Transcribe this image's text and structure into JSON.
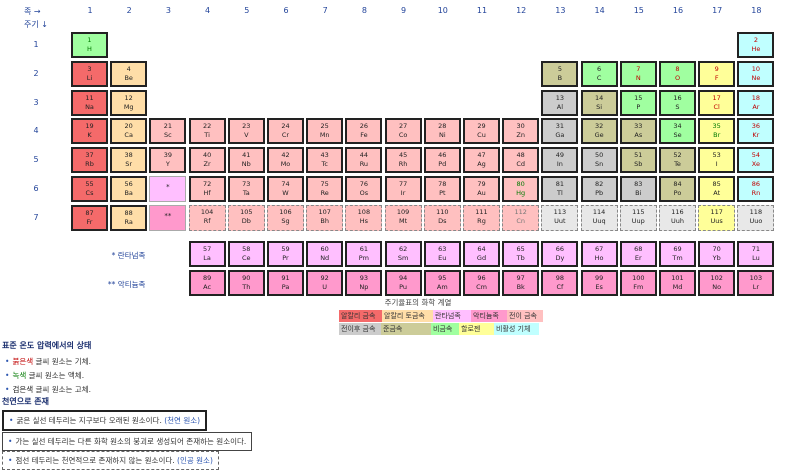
{
  "header": {
    "group_label": "족 →",
    "period_label": "주기 ↓"
  },
  "groups": [
    "1",
    "2",
    "3",
    "4",
    "5",
    "6",
    "7",
    "8",
    "9",
    "10",
    "11",
    "12",
    "13",
    "14",
    "15",
    "16",
    "17",
    "18"
  ],
  "periods": [
    "1",
    "2",
    "3",
    "4",
    "5",
    "6",
    "7"
  ],
  "colors": {
    "alkali": "#f46a6a",
    "alkaline": "#ffdea8",
    "lanthanide": "#ffbfff",
    "actinide": "#ff99cc",
    "transition": "#ffc0c0",
    "post_transition": "#cccccc",
    "metalloid": "#cccc99",
    "nonmetal": "#a0ffa0",
    "halogen": "#ffff99",
    "noble": "#c0ffff",
    "unknown": "#e8e8e8"
  },
  "text_colors": {
    "red": "#c00000",
    "green": "#007a00",
    "black": "#222222",
    "gray": "#777777"
  },
  "elements": [
    {
      "n": "1",
      "s": "H",
      "g": 1,
      "p": 1,
      "c": "nonmetal",
      "t": "green",
      "b": "nat"
    },
    {
      "n": "2",
      "s": "He",
      "g": 18,
      "p": 1,
      "c": "noble",
      "t": "red",
      "b": "nat"
    },
    {
      "n": "3",
      "s": "Li",
      "g": 1,
      "p": 2,
      "c": "alkali",
      "t": "black",
      "b": "nat"
    },
    {
      "n": "4",
      "s": "Be",
      "g": 2,
      "p": 2,
      "c": "alkaline",
      "t": "black",
      "b": "nat"
    },
    {
      "n": "5",
      "s": "B",
      "g": 13,
      "p": 2,
      "c": "metalloid",
      "t": "black",
      "b": "nat"
    },
    {
      "n": "6",
      "s": "C",
      "g": 14,
      "p": 2,
      "c": "nonmetal",
      "t": "black",
      "b": "nat"
    },
    {
      "n": "7",
      "s": "N",
      "g": 15,
      "p": 2,
      "c": "nonmetal",
      "t": "red",
      "b": "nat"
    },
    {
      "n": "8",
      "s": "O",
      "g": 16,
      "p": 2,
      "c": "nonmetal",
      "t": "red",
      "b": "nat"
    },
    {
      "n": "9",
      "s": "F",
      "g": 17,
      "p": 2,
      "c": "halogen",
      "t": "red",
      "b": "nat"
    },
    {
      "n": "10",
      "s": "Ne",
      "g": 18,
      "p": 2,
      "c": "noble",
      "t": "red",
      "b": "nat"
    },
    {
      "n": "11",
      "s": "Na",
      "g": 1,
      "p": 3,
      "c": "alkali",
      "t": "black",
      "b": "nat"
    },
    {
      "n": "12",
      "s": "Mg",
      "g": 2,
      "p": 3,
      "c": "alkaline",
      "t": "black",
      "b": "nat"
    },
    {
      "n": "13",
      "s": "Al",
      "g": 13,
      "p": 3,
      "c": "post_transition",
      "t": "black",
      "b": "nat"
    },
    {
      "n": "14",
      "s": "Si",
      "g": 14,
      "p": 3,
      "c": "metalloid",
      "t": "black",
      "b": "nat"
    },
    {
      "n": "15",
      "s": "P",
      "g": 15,
      "p": 3,
      "c": "nonmetal",
      "t": "black",
      "b": "nat"
    },
    {
      "n": "16",
      "s": "S",
      "g": 16,
      "p": 3,
      "c": "nonmetal",
      "t": "black",
      "b": "nat"
    },
    {
      "n": "17",
      "s": "Cl",
      "g": 17,
      "p": 3,
      "c": "halogen",
      "t": "red",
      "b": "nat"
    },
    {
      "n": "18",
      "s": "Ar",
      "g": 18,
      "p": 3,
      "c": "noble",
      "t": "red",
      "b": "nat"
    },
    {
      "n": "19",
      "s": "K",
      "g": 1,
      "p": 4,
      "c": "alkali",
      "t": "black",
      "b": "nat"
    },
    {
      "n": "20",
      "s": "Ca",
      "g": 2,
      "p": 4,
      "c": "alkaline",
      "t": "black",
      "b": "nat"
    },
    {
      "n": "21",
      "s": "Sc",
      "g": 3,
      "p": 4,
      "c": "transition",
      "t": "black",
      "b": "nat"
    },
    {
      "n": "22",
      "s": "Ti",
      "g": 4,
      "p": 4,
      "c": "transition",
      "t": "black",
      "b": "nat"
    },
    {
      "n": "23",
      "s": "V",
      "g": 5,
      "p": 4,
      "c": "transition",
      "t": "black",
      "b": "nat"
    },
    {
      "n": "24",
      "s": "Cr",
      "g": 6,
      "p": 4,
      "c": "transition",
      "t": "black",
      "b": "nat"
    },
    {
      "n": "25",
      "s": "Mn",
      "g": 7,
      "p": 4,
      "c": "transition",
      "t": "black",
      "b": "nat"
    },
    {
      "n": "26",
      "s": "Fe",
      "g": 8,
      "p": 4,
      "c": "transition",
      "t": "black",
      "b": "nat"
    },
    {
      "n": "27",
      "s": "Co",
      "g": 9,
      "p": 4,
      "c": "transition",
      "t": "black",
      "b": "nat"
    },
    {
      "n": "28",
      "s": "Ni",
      "g": 10,
      "p": 4,
      "c": "transition",
      "t": "black",
      "b": "nat"
    },
    {
      "n": "29",
      "s": "Cu",
      "g": 11,
      "p": 4,
      "c": "transition",
      "t": "black",
      "b": "nat"
    },
    {
      "n": "30",
      "s": "Zn",
      "g": 12,
      "p": 4,
      "c": "transition",
      "t": "black",
      "b": "nat"
    },
    {
      "n": "31",
      "s": "Ga",
      "g": 13,
      "p": 4,
      "c": "post_transition",
      "t": "black",
      "b": "nat"
    },
    {
      "n": "32",
      "s": "Ge",
      "g": 14,
      "p": 4,
      "c": "metalloid",
      "t": "black",
      "b": "nat"
    },
    {
      "n": "33",
      "s": "As",
      "g": 15,
      "p": 4,
      "c": "metalloid",
      "t": "black",
      "b": "nat"
    },
    {
      "n": "34",
      "s": "Se",
      "g": 16,
      "p": 4,
      "c": "nonmetal",
      "t": "black",
      "b": "nat"
    },
    {
      "n": "35",
      "s": "Br",
      "g": 17,
      "p": 4,
      "c": "halogen",
      "t": "green",
      "b": "nat"
    },
    {
      "n": "36",
      "s": "Kr",
      "g": 18,
      "p": 4,
      "c": "noble",
      "t": "red",
      "b": "nat"
    },
    {
      "n": "37",
      "s": "Rb",
      "g": 1,
      "p": 5,
      "c": "alkali",
      "t": "black",
      "b": "nat"
    },
    {
      "n": "38",
      "s": "Sr",
      "g": 2,
      "p": 5,
      "c": "alkaline",
      "t": "black",
      "b": "nat"
    },
    {
      "n": "39",
      "s": "Y",
      "g": 3,
      "p": 5,
      "c": "transition",
      "t": "black",
      "b": "nat"
    },
    {
      "n": "40",
      "s": "Zr",
      "g": 4,
      "p": 5,
      "c": "transition",
      "t": "black",
      "b": "nat"
    },
    {
      "n": "41",
      "s": "Nb",
      "g": 5,
      "p": 5,
      "c": "transition",
      "t": "black",
      "b": "nat"
    },
    {
      "n": "42",
      "s": "Mo",
      "g": 6,
      "p": 5,
      "c": "transition",
      "t": "black",
      "b": "nat"
    },
    {
      "n": "43",
      "s": "Tc",
      "g": 7,
      "p": 5,
      "c": "transition",
      "t": "black",
      "b": "nat"
    },
    {
      "n": "44",
      "s": "Ru",
      "g": 8,
      "p": 5,
      "c": "transition",
      "t": "black",
      "b": "nat"
    },
    {
      "n": "45",
      "s": "Rh",
      "g": 9,
      "p": 5,
      "c": "transition",
      "t": "black",
      "b": "nat"
    },
    {
      "n": "46",
      "s": "Pd",
      "g": 10,
      "p": 5,
      "c": "transition",
      "t": "black",
      "b": "nat"
    },
    {
      "n": "47",
      "s": "Ag",
      "g": 11,
      "p": 5,
      "c": "transition",
      "t": "black",
      "b": "nat"
    },
    {
      "n": "48",
      "s": "Cd",
      "g": 12,
      "p": 5,
      "c": "transition",
      "t": "black",
      "b": "nat"
    },
    {
      "n": "49",
      "s": "In",
      "g": 13,
      "p": 5,
      "c": "post_transition",
      "t": "black",
      "b": "nat"
    },
    {
      "n": "50",
      "s": "Sn",
      "g": 14,
      "p": 5,
      "c": "post_transition",
      "t": "black",
      "b": "nat"
    },
    {
      "n": "51",
      "s": "Sb",
      "g": 15,
      "p": 5,
      "c": "metalloid",
      "t": "black",
      "b": "nat"
    },
    {
      "n": "52",
      "s": "Te",
      "g": 16,
      "p": 5,
      "c": "metalloid",
      "t": "black",
      "b": "nat"
    },
    {
      "n": "53",
      "s": "I",
      "g": 17,
      "p": 5,
      "c": "halogen",
      "t": "black",
      "b": "nat"
    },
    {
      "n": "54",
      "s": "Xe",
      "g": 18,
      "p": 5,
      "c": "noble",
      "t": "red",
      "b": "nat"
    },
    {
      "n": "55",
      "s": "Cs",
      "g": 1,
      "p": 6,
      "c": "alkali",
      "t": "black",
      "b": "nat"
    },
    {
      "n": "56",
      "s": "Ba",
      "g": 2,
      "p": 6,
      "c": "alkaline",
      "t": "black",
      "b": "nat"
    },
    {
      "n": "*",
      "s": "",
      "g": 3,
      "p": 6,
      "c": "lanthanide",
      "t": "black",
      "b": "star"
    },
    {
      "n": "72",
      "s": "Hf",
      "g": 4,
      "p": 6,
      "c": "transition",
      "t": "black",
      "b": "nat"
    },
    {
      "n": "73",
      "s": "Ta",
      "g": 5,
      "p": 6,
      "c": "transition",
      "t": "black",
      "b": "nat"
    },
    {
      "n": "74",
      "s": "W",
      "g": 6,
      "p": 6,
      "c": "transition",
      "t": "black",
      "b": "nat"
    },
    {
      "n": "75",
      "s": "Re",
      "g": 7,
      "p": 6,
      "c": "transition",
      "t": "black",
      "b": "nat"
    },
    {
      "n": "76",
      "s": "Os",
      "g": 8,
      "p": 6,
      "c": "transition",
      "t": "black",
      "b": "nat"
    },
    {
      "n": "77",
      "s": "Ir",
      "g": 9,
      "p": 6,
      "c": "transition",
      "t": "black",
      "b": "nat"
    },
    {
      "n": "78",
      "s": "Pt",
      "g": 10,
      "p": 6,
      "c": "transition",
      "t": "black",
      "b": "nat"
    },
    {
      "n": "79",
      "s": "Au",
      "g": 11,
      "p": 6,
      "c": "transition",
      "t": "black",
      "b": "nat"
    },
    {
      "n": "80",
      "s": "Hg",
      "g": 12,
      "p": 6,
      "c": "transition",
      "t": "green",
      "b": "nat"
    },
    {
      "n": "81",
      "s": "Tl",
      "g": 13,
      "p": 6,
      "c": "post_transition",
      "t": "black",
      "b": "nat"
    },
    {
      "n": "82",
      "s": "Pb",
      "g": 14,
      "p": 6,
      "c": "post_transition",
      "t": "black",
      "b": "nat"
    },
    {
      "n": "83",
      "s": "Bi",
      "g": 15,
      "p": 6,
      "c": "post_transition",
      "t": "black",
      "b": "nat"
    },
    {
      "n": "84",
      "s": "Po",
      "g": 16,
      "p": 6,
      "c": "metalloid",
      "t": "black",
      "b": "nat"
    },
    {
      "n": "85",
      "s": "At",
      "g": 17,
      "p": 6,
      "c": "halogen",
      "t": "black",
      "b": "nat"
    },
    {
      "n": "86",
      "s": "Rn",
      "g": 18,
      "p": 6,
      "c": "noble",
      "t": "red",
      "b": "nat"
    },
    {
      "n": "87",
      "s": "Fr",
      "g": 1,
      "p": 7,
      "c": "alkali",
      "t": "black",
      "b": "nat"
    },
    {
      "n": "88",
      "s": "Ra",
      "g": 2,
      "p": 7,
      "c": "alkaline",
      "t": "black",
      "b": "nat"
    },
    {
      "n": "**",
      "s": "",
      "g": 3,
      "p": 7,
      "c": "actinide",
      "t": "black",
      "b": "star"
    },
    {
      "n": "104",
      "s": "Rf",
      "g": 4,
      "p": 7,
      "c": "transition",
      "t": "black",
      "b": "syn"
    },
    {
      "n": "105",
      "s": "Db",
      "g": 5,
      "p": 7,
      "c": "transition",
      "t": "black",
      "b": "syn"
    },
    {
      "n": "106",
      "s": "Sg",
      "g": 6,
      "p": 7,
      "c": "transition",
      "t": "black",
      "b": "syn"
    },
    {
      "n": "107",
      "s": "Bh",
      "g": 7,
      "p": 7,
      "c": "transition",
      "t": "black",
      "b": "syn"
    },
    {
      "n": "108",
      "s": "Hs",
      "g": 8,
      "p": 7,
      "c": "transition",
      "t": "black",
      "b": "syn"
    },
    {
      "n": "109",
      "s": "Mt",
      "g": 9,
      "p": 7,
      "c": "transition",
      "t": "black",
      "b": "syn"
    },
    {
      "n": "110",
      "s": "Ds",
      "g": 10,
      "p": 7,
      "c": "transition",
      "t": "black",
      "b": "syn"
    },
    {
      "n": "111",
      "s": "Rg",
      "g": 11,
      "p": 7,
      "c": "transition",
      "t": "black",
      "b": "syn"
    },
    {
      "n": "112",
      "s": "Cn",
      "g": 12,
      "p": 7,
      "c": "transition",
      "t": "gray",
      "b": "syn"
    },
    {
      "n": "113",
      "s": "Uut",
      "g": 13,
      "p": 7,
      "c": "unknown",
      "t": "black",
      "b": "syn"
    },
    {
      "n": "114",
      "s": "Uuq",
      "g": 14,
      "p": 7,
      "c": "unknown",
      "t": "black",
      "b": "syn"
    },
    {
      "n": "115",
      "s": "Uup",
      "g": 15,
      "p": 7,
      "c": "unknown",
      "t": "black",
      "b": "syn"
    },
    {
      "n": "116",
      "s": "Uuh",
      "g": 16,
      "p": 7,
      "c": "unknown",
      "t": "black",
      "b": "syn"
    },
    {
      "n": "117",
      "s": "Uus",
      "g": 17,
      "p": 7,
      "c": "halogen",
      "t": "black",
      "b": "syn"
    },
    {
      "n": "118",
      "s": "Uuo",
      "g": 18,
      "p": 7,
      "c": "unknown",
      "t": "black",
      "b": "syn"
    }
  ],
  "series": [
    {
      "label": "* 란타넘족",
      "row": 1,
      "c": "lanthanide",
      "items": [
        {
          "n": "57",
          "s": "La"
        },
        {
          "n": "58",
          "s": "Ce"
        },
        {
          "n": "59",
          "s": "Pr"
        },
        {
          "n": "60",
          "s": "Nd"
        },
        {
          "n": "61",
          "s": "Pm"
        },
        {
          "n": "62",
          "s": "Sm"
        },
        {
          "n": "63",
          "s": "Eu"
        },
        {
          "n": "64",
          "s": "Gd"
        },
        {
          "n": "65",
          "s": "Tb"
        },
        {
          "n": "66",
          "s": "Dy"
        },
        {
          "n": "67",
          "s": "Ho"
        },
        {
          "n": "68",
          "s": "Er"
        },
        {
          "n": "69",
          "s": "Tm"
        },
        {
          "n": "70",
          "s": "Yb"
        },
        {
          "n": "71",
          "s": "Lu"
        }
      ]
    },
    {
      "label": "** 악티늄족",
      "row": 2,
      "c": "actinide",
      "items": [
        {
          "n": "89",
          "s": "Ac"
        },
        {
          "n": "90",
          "s": "Th"
        },
        {
          "n": "91",
          "s": "Pa"
        },
        {
          "n": "92",
          "s": "U"
        },
        {
          "n": "93",
          "s": "Np"
        },
        {
          "n": "94",
          "s": "Pu"
        },
        {
          "n": "95",
          "s": "Am"
        },
        {
          "n": "96",
          "s": "Cm"
        },
        {
          "n": "97",
          "s": "Bk"
        },
        {
          "n": "98",
          "s": "Cf"
        },
        {
          "n": "99",
          "s": "Es"
        },
        {
          "n": "100",
          "s": "Fm"
        },
        {
          "n": "101",
          "s": "Md"
        },
        {
          "n": "102",
          "s": "No"
        },
        {
          "n": "103",
          "s": "Lr"
        }
      ]
    }
  ],
  "legend": {
    "title": "주기율표의 화학 계열",
    "row1": [
      {
        "label": "알칼리 금속",
        "c": "alkali"
      },
      {
        "label": "알칼리 토금속",
        "c": "alkaline"
      },
      {
        "label": "란타넘족",
        "c": "lanthanide"
      },
      {
        "label": "악티늄족",
        "c": "actinide"
      },
      {
        "label": "전이 금속",
        "c": "transition"
      }
    ],
    "row2": [
      {
        "label": "전이후 금속",
        "c": "post_transition"
      },
      {
        "label": "준금속",
        "c": "metalloid"
      },
      {
        "label": "비금속",
        "c": "nonmetal"
      },
      {
        "label": "할로젠",
        "c": "halogen"
      },
      {
        "label": "비활성 기체",
        "c": "noble"
      }
    ]
  },
  "notes": {
    "state_title": "표준 온도 압력에서의 상태",
    "state_items": [
      {
        "word": "붉은색",
        "rest": " 글씨 원소는 기체.",
        "t": "red"
      },
      {
        "word": "녹색",
        "rest": " 글씨 원소는 액체.",
        "t": "green"
      },
      {
        "word": "검은색",
        "rest": " 글씨 원소는 고체.",
        "t": "black"
      }
    ],
    "nature_title": "천연으로 존재",
    "nature_items": [
      {
        "text": "굵은 실선 테두리는 지구보다 오래된 원소이다. ",
        "link": "(천연 원소)",
        "border": "thick"
      },
      {
        "text": "가는 실선 테두리는 다른 화학 원소의 붕괴로 생성되어 존재하는 원소이다.",
        "link": "",
        "border": "thin"
      },
      {
        "text": "점선 테두리는 천연적으로 존재하지 않는 원소이다. ",
        "link": "(인공 원소)",
        "border": "dashed"
      }
    ]
  }
}
